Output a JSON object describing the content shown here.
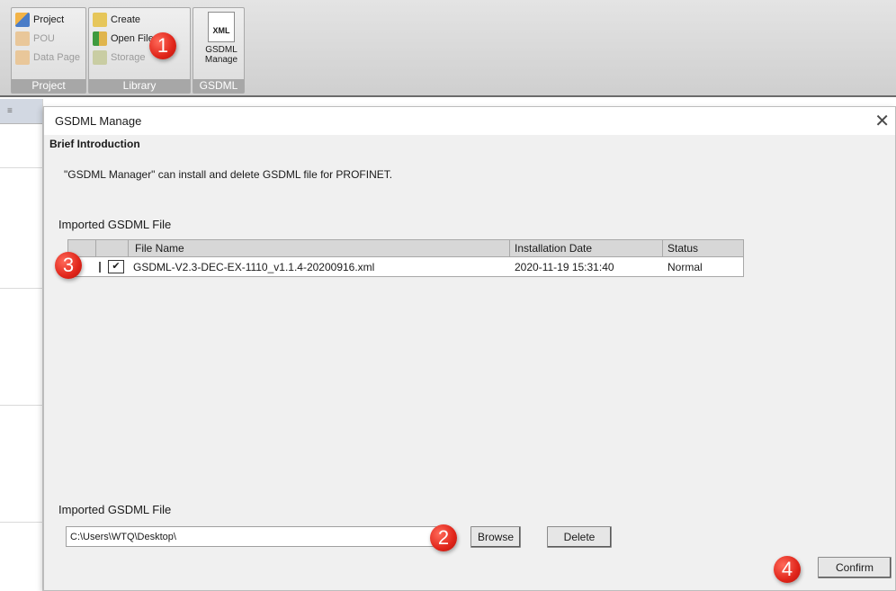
{
  "ribbon": {
    "project_group": {
      "label": "Project",
      "items": [
        {
          "label": "Project",
          "icon": "project-icon",
          "enabled": true
        },
        {
          "label": "POU",
          "icon": "pou-icon",
          "enabled": false
        },
        {
          "label": "Data Page",
          "icon": "data-page-icon",
          "enabled": false
        }
      ]
    },
    "library_group": {
      "label": "Library",
      "items": [
        {
          "label": "Create",
          "icon": "create-icon",
          "enabled": true
        },
        {
          "label": "Open File",
          "icon": "open-file-icon",
          "enabled": true
        },
        {
          "label": "Storage",
          "icon": "storage-icon",
          "enabled": false
        }
      ]
    },
    "gsdml_group": {
      "label": "GSDML",
      "button_line1": "GSDML",
      "button_line2": "Manage",
      "icon_text": "XML",
      "icon": "xml-file-icon"
    }
  },
  "dialog": {
    "title": "GSDML Manage",
    "close_glyph": "✕",
    "section_title": "Brief Introduction",
    "intro_text": "\"GSDML Manager\" can install and delete GSDML file for PROFINET.",
    "imported_label": "Imported GSDML File",
    "table": {
      "columns": [
        "File Name",
        "Installation Date",
        "Status"
      ],
      "rows": [
        {
          "checked": true,
          "file_name": "GSDML-V2.3-DEC-EX-1110_v1.1.4-20200916.xml",
          "installation_date": "2020-11-19 15:31:40",
          "status": "Normal"
        }
      ]
    },
    "import_label": "Imported GSDML File",
    "path_value": "C:\\Users\\WTQ\\Desktop\\",
    "browse_label": "Browse",
    "delete_label": "Delete",
    "confirm_label": "Confirm"
  },
  "callouts": [
    "1",
    "2",
    "3",
    "4"
  ],
  "colors": {
    "callout_red": "#e0251a",
    "ribbon_group_label_bg": "#a7a7a7",
    "dialog_bg": "#f0f0f0"
  }
}
